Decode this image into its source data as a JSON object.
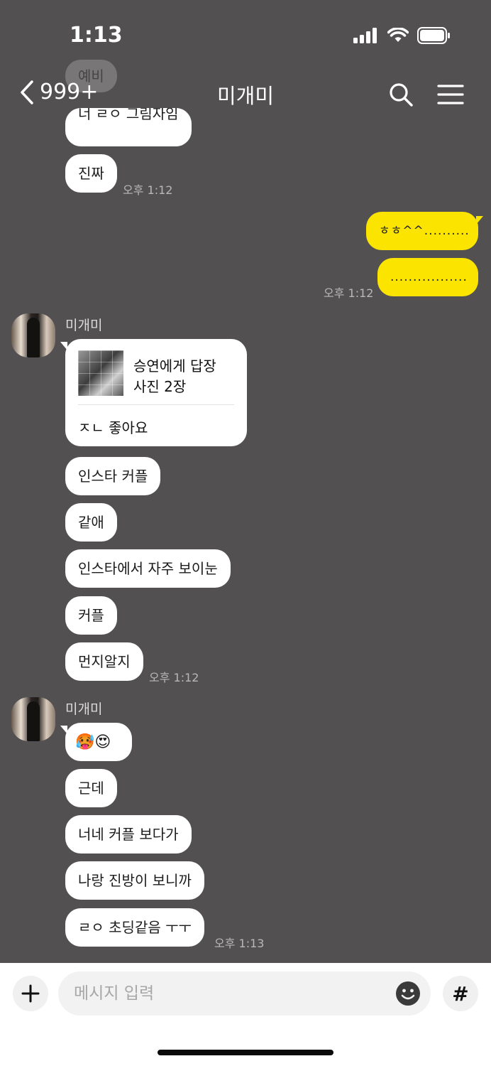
{
  "status_bar": {
    "time": "1:13"
  },
  "header": {
    "back_count": "999+",
    "title": "미개미"
  },
  "faded_top": {
    "label": "예비",
    "partial_message": "너 ㄹㅇ 그림자임"
  },
  "messages": {
    "m_jinjja": "진짜",
    "t_1": "오후 1:12",
    "mine_1": "ㅎㅎ^^..........",
    "mine_2": ".................",
    "t_2": "오후 1:12",
    "sender_1": "미개미",
    "reply_card": {
      "title": "승연에게 답장",
      "subtitle": "사진 2장",
      "text": "ㅈㄴ 좋아요"
    },
    "m_insta_couple": "인스타 커플",
    "m_gatae": "같애",
    "m_insta_often": "인스타에서 자주 보이눈",
    "m_couple": "커플",
    "m_meonji": "먼지알지",
    "t_3": "오후 1:12",
    "sender_2": "미개미",
    "m_emoji": "🥵😍",
    "m_gunde": "근데",
    "m_neone": "너네 커플 보다가",
    "m_narang": "나랑 진방이 보니까",
    "m_choding": "ㄹㅇ 초딩같음 ㅜㅜ",
    "t_4": "오후 1:13"
  },
  "input": {
    "placeholder": "메시지 입력",
    "hash_label": "#"
  },
  "colors": {
    "background": "#525051",
    "my_bubble": "#fbe400",
    "other_bubble": "#ffffff"
  }
}
